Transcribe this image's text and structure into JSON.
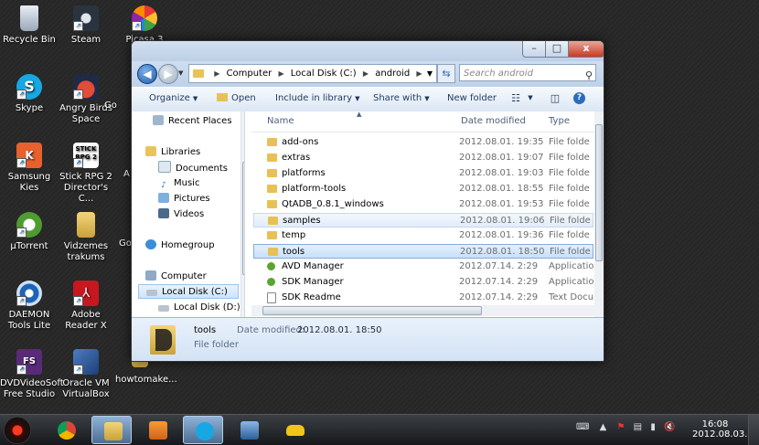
{
  "desktop": {
    "icons": [
      {
        "label": "Recycle Bin",
        "icon": "recycle-bin-icon"
      },
      {
        "label": "Steam",
        "icon": "steam-icon"
      },
      {
        "label": "Picasa 3",
        "icon": "picasa-icon"
      },
      {
        "label": "Skype",
        "icon": "skype-icon"
      },
      {
        "label": "Angry Birds Space",
        "icon": "angry-birds-icon"
      },
      {
        "label": "Go",
        "icon": "generic-icon"
      },
      {
        "label": "Samsung Kies",
        "icon": "kies-icon"
      },
      {
        "label": "Stick RPG 2 Director's C...",
        "icon": "stick-rpg-icon"
      },
      {
        "label": "A",
        "icon": "generic-icon"
      },
      {
        "label": "µTorrent",
        "icon": "utorrent-icon"
      },
      {
        "label": "Vidzemes trakums",
        "icon": "folder-icon"
      },
      {
        "label": "Go",
        "icon": "generic-icon"
      },
      {
        "label": "DAEMON Tools Lite",
        "icon": "daemon-tools-icon"
      },
      {
        "label": "Adobe Reader X",
        "icon": "adobe-reader-icon"
      },
      {
        "label": "DVDVideoSoft Free Studio",
        "icon": "dvdvideosoft-icon"
      },
      {
        "label": "Oracle VM VirtualBox",
        "icon": "virtualbox-icon"
      },
      {
        "label": "howtomake...",
        "icon": "folder-icon"
      }
    ]
  },
  "window": {
    "controls": {
      "minimize": "–",
      "maximize": "□",
      "close": "x"
    },
    "address": {
      "parts": [
        "Computer",
        "Local Disk (C:)",
        "android"
      ]
    },
    "search_placeholder": "Search android",
    "toolbar": {
      "organize": "Organize",
      "open": "Open",
      "include": "Include in library",
      "share": "Share with",
      "new_folder": "New folder"
    },
    "nav": {
      "recent": "Recent Places",
      "libraries": "Libraries",
      "documents": "Documents",
      "music": "Music",
      "pictures": "Pictures",
      "videos": "Videos",
      "homegroup": "Homegroup",
      "computer": "Computer",
      "disk_c": "Local Disk (C:)",
      "disk_d": "Local Disk (D:)"
    },
    "columns": {
      "name": "Name",
      "date": "Date modified",
      "type": "Type"
    },
    "files": [
      {
        "name": "add-ons",
        "date": "2012.08.01. 19:35",
        "type": "File folde",
        "kind": "folder"
      },
      {
        "name": "extras",
        "date": "2012.08.01. 19:07",
        "type": "File folde",
        "kind": "folder"
      },
      {
        "name": "platforms",
        "date": "2012.08.01. 19:03",
        "type": "File folde",
        "kind": "folder"
      },
      {
        "name": "platform-tools",
        "date": "2012.08.01. 18:55",
        "type": "File folde",
        "kind": "folder"
      },
      {
        "name": "QtADB_0.8.1_windows",
        "date": "2012.08.01. 19:53",
        "type": "File folde",
        "kind": "folder"
      },
      {
        "name": "samples",
        "date": "2012.08.01. 19:06",
        "type": "File folde",
        "kind": "folder"
      },
      {
        "name": "temp",
        "date": "2012.08.01. 19:36",
        "type": "File folde",
        "kind": "folder"
      },
      {
        "name": "tools",
        "date": "2012.08.01. 18:50",
        "type": "File folde",
        "kind": "folder"
      },
      {
        "name": "AVD Manager",
        "date": "2012.07.14. 2:29",
        "type": "Applicatio",
        "kind": "app"
      },
      {
        "name": "SDK Manager",
        "date": "2012.07.14. 2:29",
        "type": "Applicatio",
        "kind": "app"
      },
      {
        "name": "SDK Readme",
        "date": "2012.07.14. 2:29",
        "type": "Text Docu",
        "kind": "doc"
      }
    ],
    "details": {
      "name": "tools",
      "date_label": "Date modified:",
      "date_value": "2012.08.01. 18:50",
      "type": "File folder"
    }
  },
  "taskbar": {
    "clock_time": "16:08",
    "clock_date": "2012.08.03."
  }
}
